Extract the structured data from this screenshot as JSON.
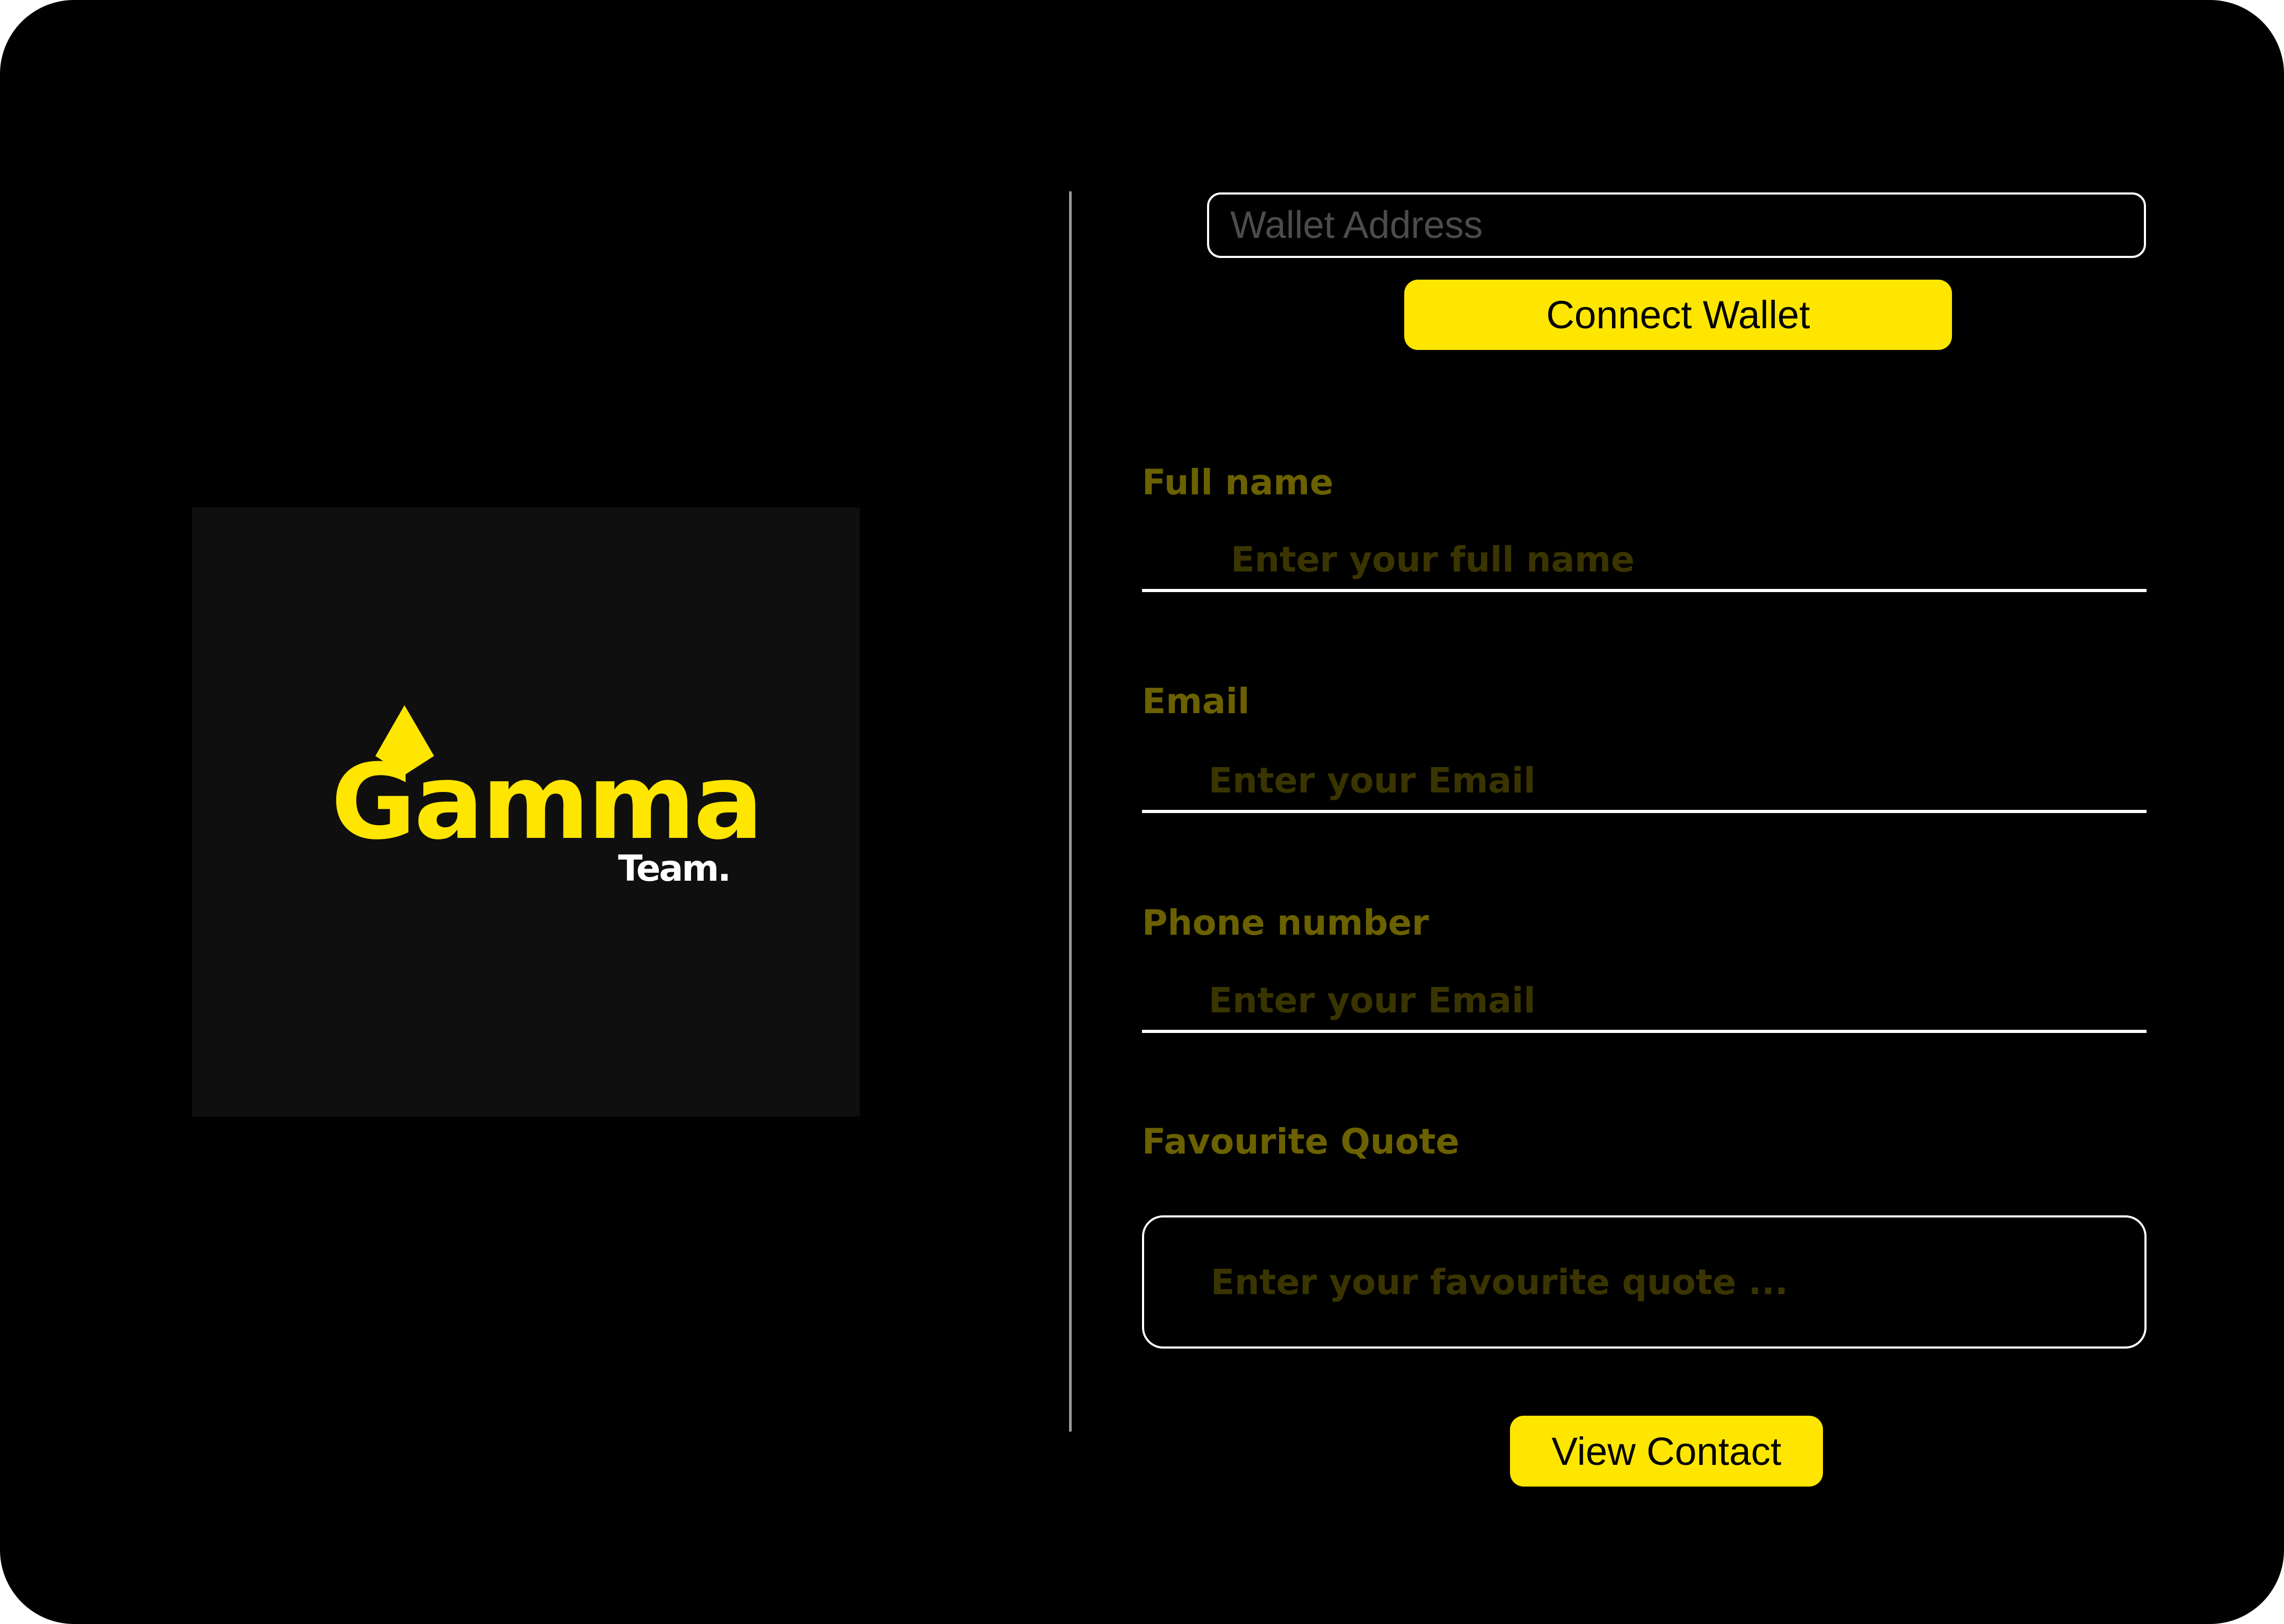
{
  "colors": {
    "background": "#000000",
    "logo_panel": "#0f0f0f",
    "accent_yellow": "#ffe600",
    "label_olive": "#6b6100",
    "placeholder_dark_olive": "#3a3500",
    "placeholder_gray": "#4c4c4c",
    "outline_white": "#ffffff",
    "divider_gray": "#9a9a9a"
  },
  "logo": {
    "word": "Gamma",
    "subtitle": "Team.",
    "mark_icon": "triangle-icon"
  },
  "wallet": {
    "placeholder": "Wallet Address",
    "value": "",
    "connect_label": "Connect Wallet"
  },
  "form": {
    "full_name": {
      "label": "Full name",
      "placeholder": "Enter your full name",
      "value": ""
    },
    "email": {
      "label": "Email",
      "placeholder": "Enter your Email",
      "value": ""
    },
    "phone": {
      "label": "Phone number",
      "placeholder": "Enter your Email",
      "value": ""
    },
    "quote": {
      "label": "Favourite Quote",
      "placeholder": "Enter your favourite quote ...",
      "value": ""
    },
    "submit_label": "View Contact"
  }
}
